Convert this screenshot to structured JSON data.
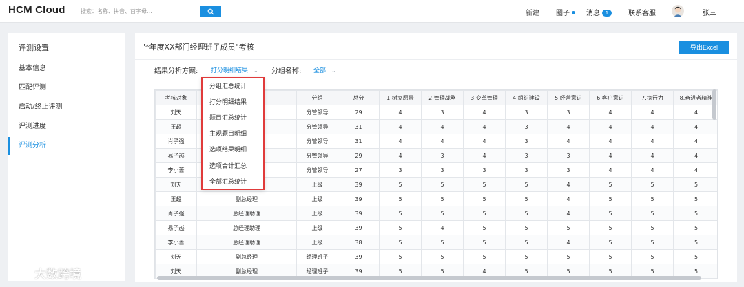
{
  "app": {
    "logo": "HCM Cloud"
  },
  "search": {
    "placeholder": "搜索：名称、拼音、首字母..."
  },
  "nav": {
    "new_label": "新建",
    "circle_label": "圈子",
    "messages_label": "消息",
    "messages_count": "1",
    "support_label": "联系客服",
    "user_name": "张三"
  },
  "sidebar": {
    "title": "评测设置",
    "items": [
      {
        "label": "基本信息"
      },
      {
        "label": "匹配评测"
      },
      {
        "label": "启动/终止评测"
      },
      {
        "label": "评测进度"
      },
      {
        "label": "评测分析"
      }
    ]
  },
  "main": {
    "title": "\"*年度XX部门经理班子成员\"考核",
    "export_label": "导出Excel",
    "filter_scheme_label": "结果分析方案:",
    "filter_scheme_value": "打分明细结果",
    "filter_group_label": "分组名称:",
    "filter_group_value": "全部"
  },
  "dropdown": {
    "items": [
      "分组汇总统计",
      "打分明细结果",
      "题目汇总统计",
      "主观题目明细",
      "选项结果明细",
      "选项合计汇总",
      "全部汇总统计"
    ]
  },
  "table": {
    "headers": [
      "考核对象",
      "",
      "分组",
      "总分",
      "1.树立愿景",
      "2.管理战略",
      "3.变革管理",
      "4.组织建设",
      "5.经营意识",
      "6.客户意识",
      "7.执行力",
      "8.奋进者精神"
    ],
    "rows": [
      [
        "刘天",
        "",
        "分管领导",
        "29",
        "4",
        "3",
        "4",
        "3",
        "3",
        "4",
        "4",
        "4"
      ],
      [
        "王超",
        "",
        "分管领导",
        "31",
        "4",
        "4",
        "4",
        "3",
        "4",
        "4",
        "4",
        "4"
      ],
      [
        "肖子强",
        "",
        "分管领导",
        "31",
        "4",
        "4",
        "4",
        "3",
        "4",
        "4",
        "4",
        "4"
      ],
      [
        "易子越",
        "",
        "分管领导",
        "29",
        "4",
        "3",
        "4",
        "3",
        "3",
        "4",
        "4",
        "4"
      ],
      [
        "李小蔷",
        "",
        "分管领导",
        "27",
        "3",
        "3",
        "3",
        "3",
        "3",
        "4",
        "4",
        "4"
      ],
      [
        "刘天",
        "",
        "上级",
        "39",
        "5",
        "5",
        "5",
        "5",
        "4",
        "5",
        "5",
        "5"
      ],
      [
        "王超",
        "副总经理",
        "上级",
        "39",
        "5",
        "5",
        "5",
        "5",
        "4",
        "5",
        "5",
        "5"
      ],
      [
        "肖子强",
        "总经理助理",
        "上级",
        "39",
        "5",
        "5",
        "5",
        "5",
        "4",
        "5",
        "5",
        "5"
      ],
      [
        "易子越",
        "总经理助理",
        "上级",
        "39",
        "5",
        "4",
        "5",
        "5",
        "5",
        "5",
        "5",
        "5"
      ],
      [
        "李小蔷",
        "总经理助理",
        "上级",
        "38",
        "5",
        "5",
        "5",
        "5",
        "4",
        "5",
        "5",
        "5"
      ],
      [
        "刘天",
        "副总经理",
        "经理班子",
        "39",
        "5",
        "5",
        "5",
        "5",
        "5",
        "5",
        "5",
        "5"
      ],
      [
        "刘天",
        "副总经理",
        "经理班子",
        "39",
        "5",
        "5",
        "4",
        "5",
        "5",
        "5",
        "5",
        "5"
      ]
    ]
  },
  "watermark": {
    "text": "大数跨境"
  },
  "colors": {
    "accent": "#1a8fe0",
    "highlight_border": "#e03b3b"
  }
}
